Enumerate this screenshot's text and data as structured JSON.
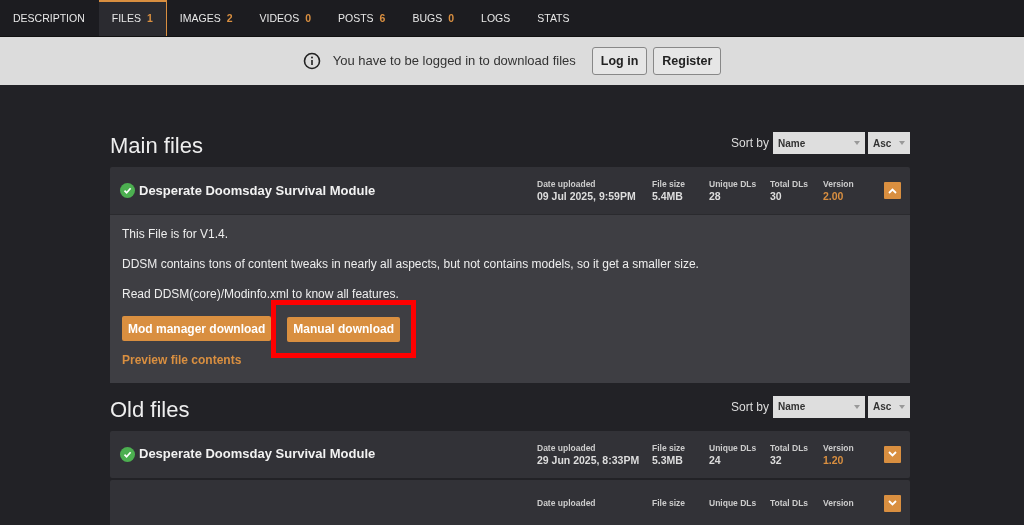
{
  "tabs": [
    {
      "label": "DESCRIPTION",
      "selected": false
    },
    {
      "label": "FILES",
      "count": "1",
      "selected": true
    },
    {
      "label": "IMAGES",
      "count": "2",
      "selected": false
    },
    {
      "label": "VIDEOS",
      "count": "0",
      "selected": false
    },
    {
      "label": "POSTS",
      "count": "6",
      "selected": false
    },
    {
      "label": "BUGS",
      "count": "0",
      "selected": false
    },
    {
      "label": "LOGS",
      "selected": false
    },
    {
      "label": "STATS",
      "selected": false
    }
  ],
  "notice": {
    "text": "You have to be logged in to download files",
    "buttons": [
      "Log in",
      "Register"
    ]
  },
  "sections": [
    {
      "title": "Main files",
      "sort_label": "Sort by",
      "sort_field": "Name",
      "sort_order": "Asc",
      "files": [
        {
          "name": "Desperate Doomsday Survival Module",
          "expanded": true,
          "stats": [
            {
              "label": "Date uploaded",
              "value": "09 Jul 2025, 9:59PM"
            },
            {
              "label": "File size",
              "value": "5.4MB"
            },
            {
              "label": "Unique DLs",
              "value": "28"
            },
            {
              "label": "Total DLs",
              "value": "30"
            },
            {
              "label": "Version",
              "value": "2.00"
            }
          ],
          "description": [
            "This File is for V1.4.",
            "DDSM contains tons of content tweaks in nearly all aspects, but not contains models, so it get a smaller size.",
            "Read DDSM(core)/Modinfo.xml to know all features."
          ],
          "buttons": [
            {
              "label": "Mod manager download",
              "highlighted": false
            },
            {
              "label": "Manual download",
              "highlighted": true
            }
          ],
          "preview_link": "Preview file contents"
        }
      ]
    },
    {
      "title": "Old files",
      "sort_label": "Sort by",
      "sort_field": "Name",
      "sort_order": "Asc",
      "files": [
        {
          "name": "Desperate Doomsday Survival Module",
          "expanded": false,
          "stats": [
            {
              "label": "Date uploaded",
              "value": "29 Jun 2025, 8:33PM"
            },
            {
              "label": "File size",
              "value": "5.3MB"
            },
            {
              "label": "Unique DLs",
              "value": "24"
            },
            {
              "label": "Total DLs",
              "value": "32"
            },
            {
              "label": "Version",
              "value": "1.20"
            }
          ]
        },
        {
          "expanded": false,
          "stats": [
            {
              "label": "Date uploaded"
            },
            {
              "label": "File size"
            },
            {
              "label": "Unique DLs"
            },
            {
              "label": "Total DLs"
            },
            {
              "label": "Version"
            }
          ]
        }
      ]
    }
  ]
}
